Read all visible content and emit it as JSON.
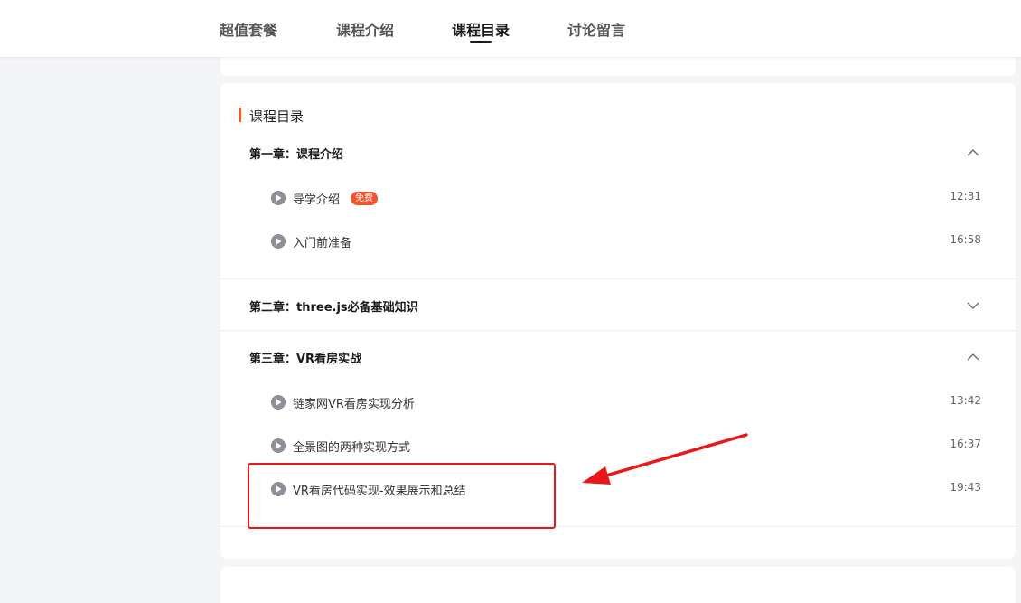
{
  "tabs": [
    {
      "label": "超值套餐"
    },
    {
      "label": "课程介绍"
    },
    {
      "label": "课程目录",
      "active": true
    },
    {
      "label": "讨论留言"
    }
  ],
  "catalog": {
    "title": "课程目录",
    "accent_color": "#f15a24",
    "chapters": [
      {
        "title": "第一章：课程介绍",
        "expanded": true,
        "lessons": [
          {
            "title": "导学介绍",
            "badge": "免费",
            "duration": "12:31"
          },
          {
            "title": "入门前准备",
            "duration": "16:58"
          }
        ]
      },
      {
        "title": "第二章：three.js必备基础知识",
        "expanded": false,
        "lessons": []
      },
      {
        "title": "第三章：VR看房实战",
        "expanded": true,
        "lessons": [
          {
            "title": "链家网VR看房实现分析",
            "duration": "13:42"
          },
          {
            "title": "全景图的两种实现方式",
            "duration": "16:37"
          },
          {
            "title": "VR看房代码实现-效果展示和总结",
            "duration": "19:43"
          }
        ]
      }
    ]
  },
  "annotation": {
    "color": "#e81818"
  }
}
